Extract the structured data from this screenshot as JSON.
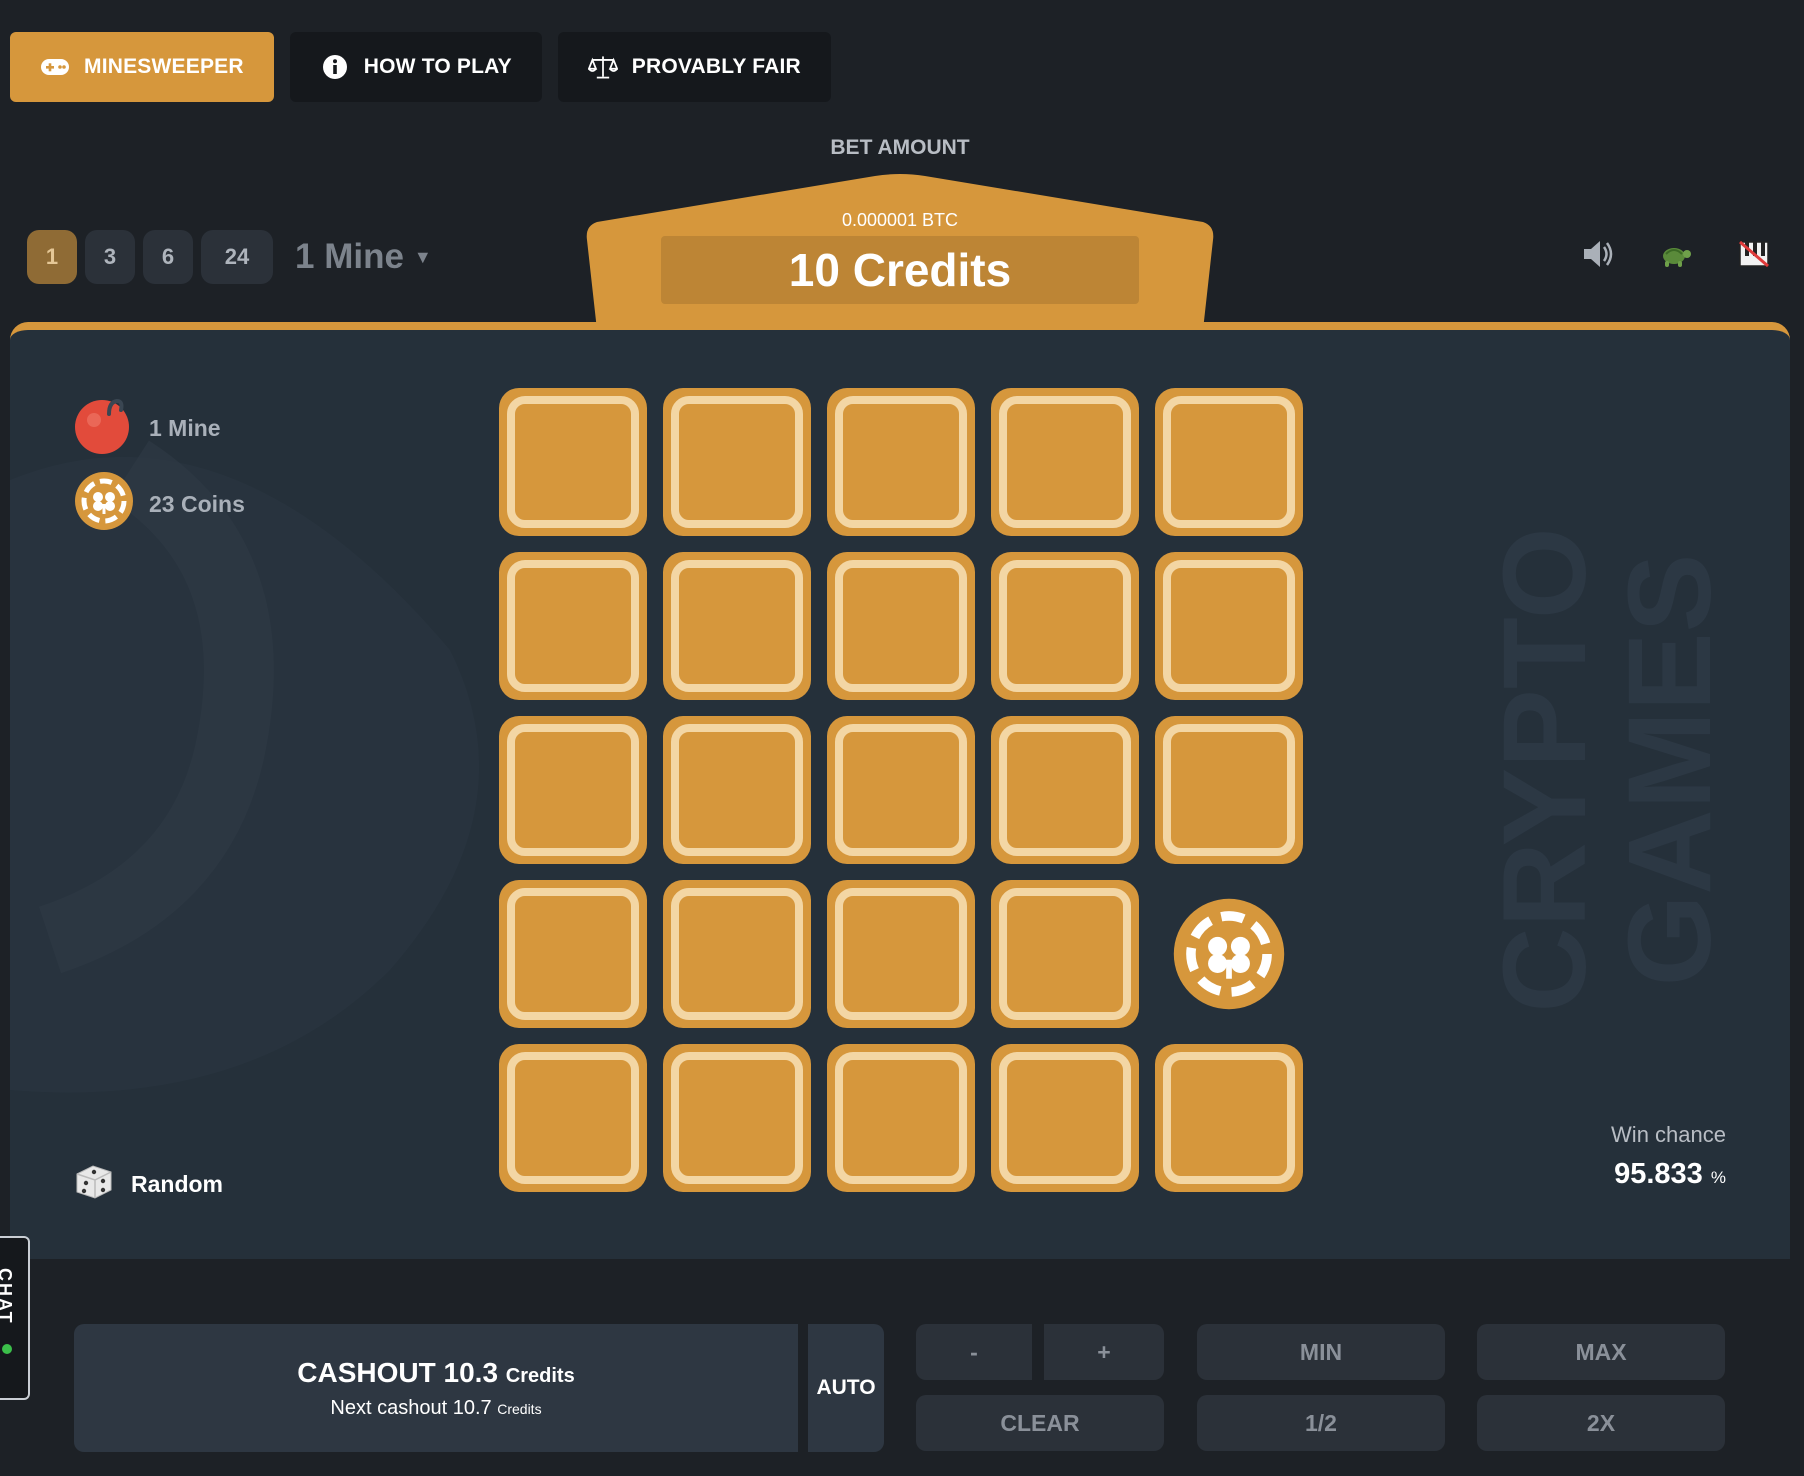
{
  "tabs": [
    {
      "label": "MINESWEEPER",
      "icon": "gamepad-icon",
      "active": true
    },
    {
      "label": "HOW TO PLAY",
      "icon": "info-icon",
      "active": false
    },
    {
      "label": "PROVABLY FAIR",
      "icon": "scale-icon",
      "active": false
    }
  ],
  "bet": {
    "label": "BET AMOUNT",
    "btc": "0.000001 BTC",
    "credits": "10 Credits"
  },
  "mine_options": [
    "1",
    "3",
    "6",
    "24"
  ],
  "mine_selected": "1",
  "mine_dropdown": "1 Mine",
  "right_icons": [
    "speaker-icon",
    "turtle-icon",
    "music-off-icon"
  ],
  "legend": {
    "mines": "1 Mine",
    "coins": "23 Coins"
  },
  "random_label": "Random",
  "grid": {
    "rows": 5,
    "cols": 5,
    "revealed": [
      {
        "row": 4,
        "col": 5,
        "content": "coin"
      }
    ]
  },
  "win_chance": {
    "label": "Win chance",
    "value": "95.833",
    "unit": "%"
  },
  "cashout": {
    "prefix": "CASHOUT",
    "amount": "10.3",
    "unit": "Credits",
    "next_prefix": "Next cashout",
    "next_amount": "10.7",
    "next_unit": "Credits"
  },
  "auto_label": "AUTO",
  "controls": {
    "minus": "-",
    "plus": "+",
    "min": "MIN",
    "max": "MAX",
    "clear": "CLEAR",
    "half": "1/2",
    "double": "2X"
  },
  "watermark": {
    "line1": "CRYPTO",
    "line2": "GAMES"
  },
  "chat_label": "CHAT",
  "colors": {
    "accent": "#d6973c",
    "accent_light": "#f3d6a4",
    "board": "#25303a",
    "background": "#1d2126"
  }
}
